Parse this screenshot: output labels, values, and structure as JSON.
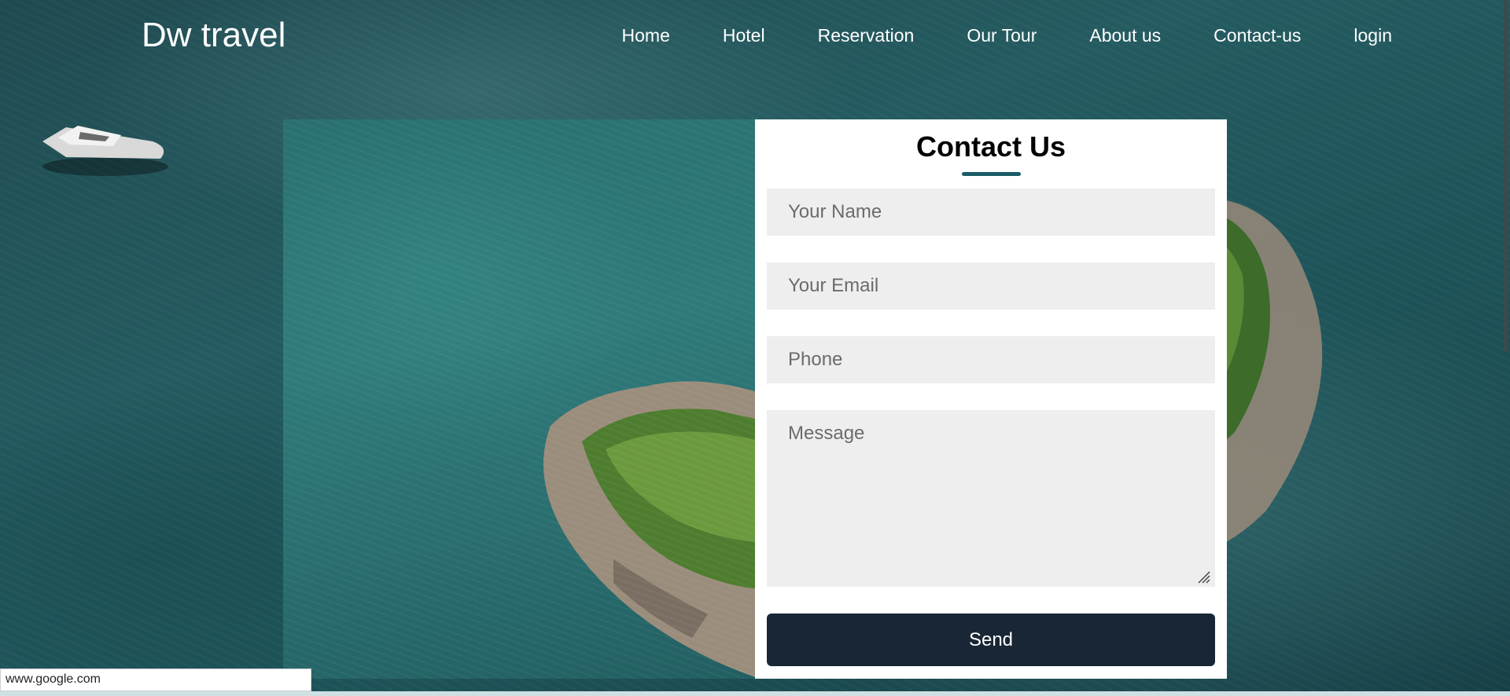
{
  "brand": {
    "name": "Dw travel"
  },
  "nav": {
    "items": [
      {
        "label": "Home"
      },
      {
        "label": "Hotel"
      },
      {
        "label": "Reservation"
      },
      {
        "label": "Our Tour"
      },
      {
        "label": "About us"
      },
      {
        "label": "Contact-us"
      },
      {
        "label": "login"
      }
    ]
  },
  "contact": {
    "title": "Contact Us",
    "name_placeholder": "Your Name",
    "email_placeholder": "Your Email",
    "phone_placeholder": "Phone",
    "message_placeholder": "Message",
    "send_label": "Send"
  },
  "status_bar": {
    "url": "www.google.com"
  },
  "colors": {
    "accent": "#1a5b66",
    "button": "#182635",
    "field_bg": "#eeeeee"
  }
}
